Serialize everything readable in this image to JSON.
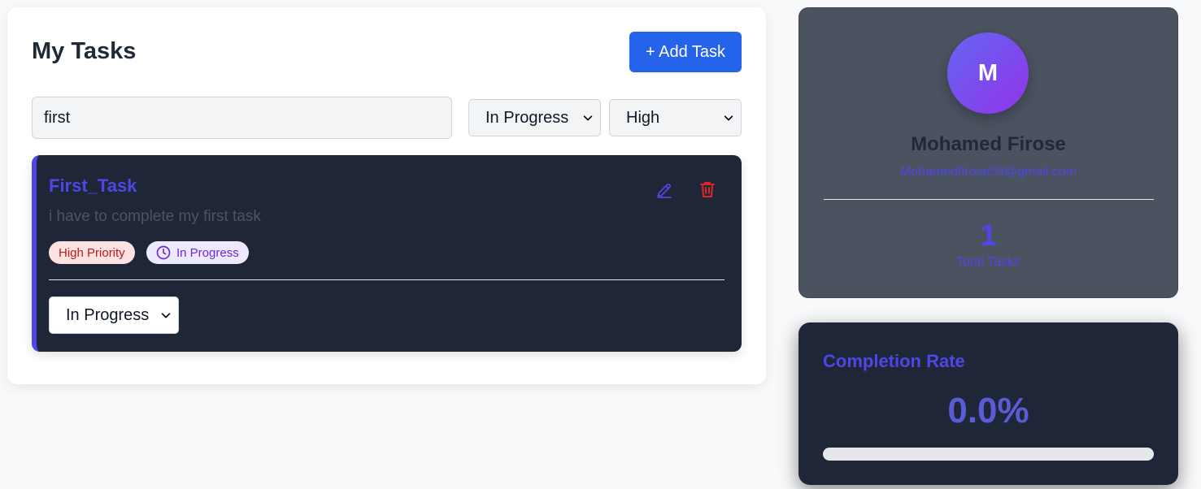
{
  "tasks_panel": {
    "title": "My Tasks",
    "add_button": "+ Add Task",
    "search": {
      "value": "first"
    },
    "status_filter": {
      "selected": "In Progress"
    },
    "priority_filter": {
      "selected": "High"
    }
  },
  "tasks": [
    {
      "title": "First_Task",
      "description": "i have to complete my first task",
      "priority_badge": "High Priority",
      "status_badge": "In Progress",
      "status_select": "In Progress",
      "edit_icon": "pencil-icon",
      "delete_icon": "trash-icon",
      "status_icon": "clock-icon"
    }
  ],
  "profile": {
    "avatar_initial": "M",
    "name": "Mohamed Firose",
    "email": "Mohamedfirose59@gmail.com",
    "total_tasks_value": "1",
    "total_tasks_label": "Total Tasks"
  },
  "completion": {
    "title": "Completion Rate",
    "value": "0.0%",
    "progress_fraction": 0.0
  },
  "colors": {
    "accent": "#4f46e5",
    "primary_button": "#2563eb",
    "danger": "#dc2626",
    "card_dark": "#1f2637",
    "profile_bg": "#4b5260"
  }
}
